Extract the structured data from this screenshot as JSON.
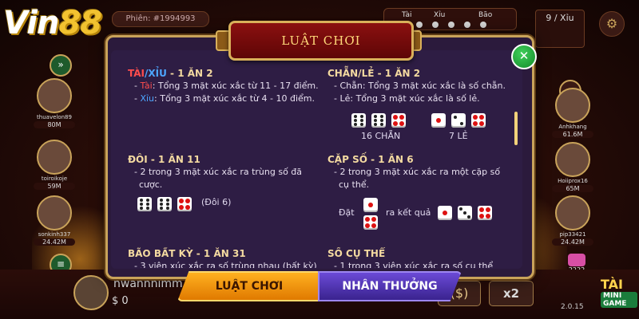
{
  "brand": {
    "logo_main": "Vin",
    "logo_num": "88"
  },
  "session": {
    "label": "Phiên: #1994993"
  },
  "history": {
    "tai": "Tài",
    "xiu": "Xỉu",
    "bao": "Bão"
  },
  "result_box": {
    "label": "9 / Xỉu"
  },
  "players_left": [
    {
      "name": "thuavelon89",
      "money": "80M"
    },
    {
      "name": "toiroikoje",
      "money": "59M"
    },
    {
      "name": "sonkinh337",
      "money": "24.42M"
    }
  ],
  "players_right": [
    {
      "name": "Anhkhang",
      "money": "61.6M"
    },
    {
      "name": "Hoiiprox16",
      "money": "65M"
    },
    {
      "name": "pip33421",
      "money": "24.42M"
    }
  ],
  "counter": {
    "value": "2222"
  },
  "modal": {
    "title": "LUẬT CHƠI",
    "close_icon": "close-icon",
    "left_col": {
      "r1_title_tai": "TÀI",
      "r1_title_slash": "/",
      "r1_title_xiu": "XỈU",
      "r1_title_rest": " - 1 ĂN 2",
      "r1_tai_label": "Tài",
      "r1_tai_text": ": Tổng 3 mặt xúc xắc từ 11 - 17 điểm.",
      "r1_xiu_label": "Xỉu",
      "r1_xiu_text": ": Tổng 3 mặt xúc xắc từ 4 - 10 điểm.",
      "r2_title": "ĐÔI - 1 ĂN 11",
      "r2_line1": "- 2 trong 3 mặt xúc xắc ra trùng số đã",
      "r2_line2": "cược.",
      "r2_caption": "(Đôi 6)",
      "r3_title": "BÃO BẤT KỲ - 1 ĂN 31",
      "r3_line1": "- 3 viên xúc xắc ra số trùng nhau (bất kỳ)"
    },
    "right_col": {
      "r1_title": "CHẴN/LẺ - 1 ĂN 2",
      "r1_chan": "- Chẵn: Tổng 3 mặt xúc xắc là số chẵn.",
      "r1_le": "- Lẻ: Tổng 3 mặt xúc xắc là số lẻ.",
      "r1_caption_chan": "16 CHẴN",
      "r1_caption_le": "7 LẺ",
      "r2_title": "CẶP SỐ - 1 ĂN 6",
      "r2_line1": "- 2 trong 3 mặt xúc xắc ra một cặp số",
      "r2_line2": "cụ thể.",
      "r2_dat": "Đặt",
      "r2_ra": "ra kết quả",
      "r3_title": "SỐ CỤ THỂ",
      "r3_line1": "- 1 trong 3 viên xúc xắc ra số cụ thể"
    },
    "tabs": {
      "rules": "LUẬT CHƠI",
      "rewards": "NHÂN THƯỞNG"
    }
  },
  "me": {
    "name": "hwannhimm",
    "money": "$ 0"
  },
  "controls": {
    "x2": "x2",
    "version": "2.0.15"
  },
  "mini_game": {
    "line1": "TÀI",
    "line2": "MINI GAME"
  }
}
